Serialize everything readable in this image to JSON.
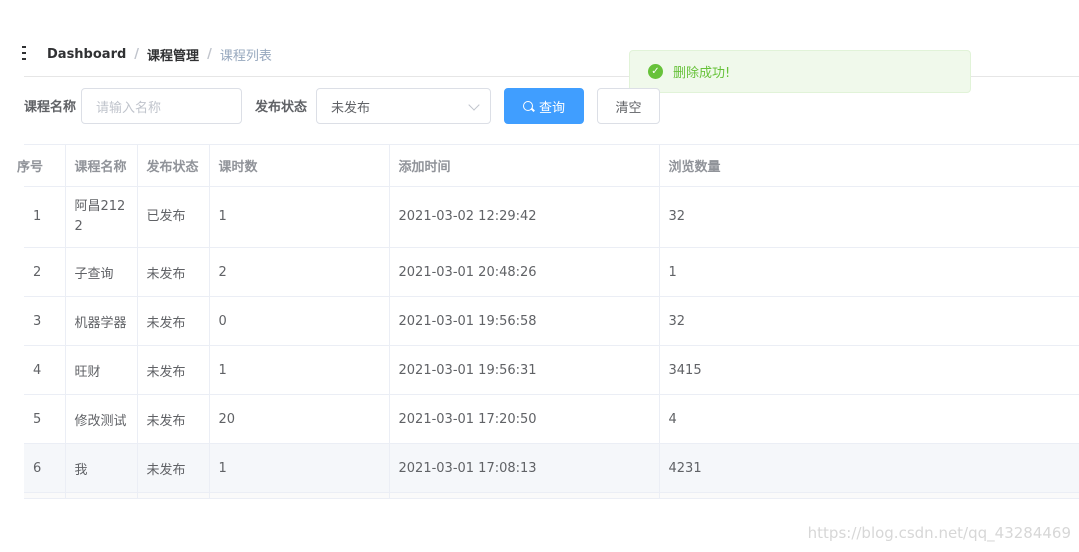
{
  "breadcrumb": {
    "home": "Dashboard",
    "section": "课程管理",
    "current": "课程列表"
  },
  "toast": {
    "message": "删除成功!",
    "type": "success",
    "color": "#67c23a"
  },
  "search": {
    "name_label": "课程名称",
    "name_placeholder": "请输入名称",
    "status_label": "发布状态",
    "status_value": "未发布",
    "query_label": "查询",
    "clear_label": "清空"
  },
  "table": {
    "columns": [
      "序号",
      "课程名称",
      "发布状态",
      "课时数",
      "添加时间",
      "浏览数量"
    ],
    "rows": [
      {
        "index": "1",
        "name": "阿昌2122",
        "status": "已发布",
        "lessons": "1",
        "created": "2021-03-02 12:29:42",
        "views": "32"
      },
      {
        "index": "2",
        "name": "子查询",
        "status": "未发布",
        "lessons": "2",
        "created": "2021-03-01 20:48:26",
        "views": "1"
      },
      {
        "index": "3",
        "name": "机器学器",
        "status": "未发布",
        "lessons": "0",
        "created": "2021-03-01 19:56:58",
        "views": "32"
      },
      {
        "index": "4",
        "name": "旺财",
        "status": "未发布",
        "lessons": "1",
        "created": "2021-03-01 19:56:31",
        "views": "3415"
      },
      {
        "index": "5",
        "name": "修改测试",
        "status": "未发布",
        "lessons": "20",
        "created": "2021-03-01 17:20:50",
        "views": "4"
      },
      {
        "index": "6",
        "name": "我",
        "status": "未发布",
        "lessons": "1",
        "created": "2021-03-01 17:08:13",
        "views": "4231"
      }
    ]
  },
  "watermark": "https://blog.csdn.net/qq_43284469",
  "colors": {
    "primary": "#409eff",
    "success": "#67c23a",
    "border": "#ebeef5"
  }
}
